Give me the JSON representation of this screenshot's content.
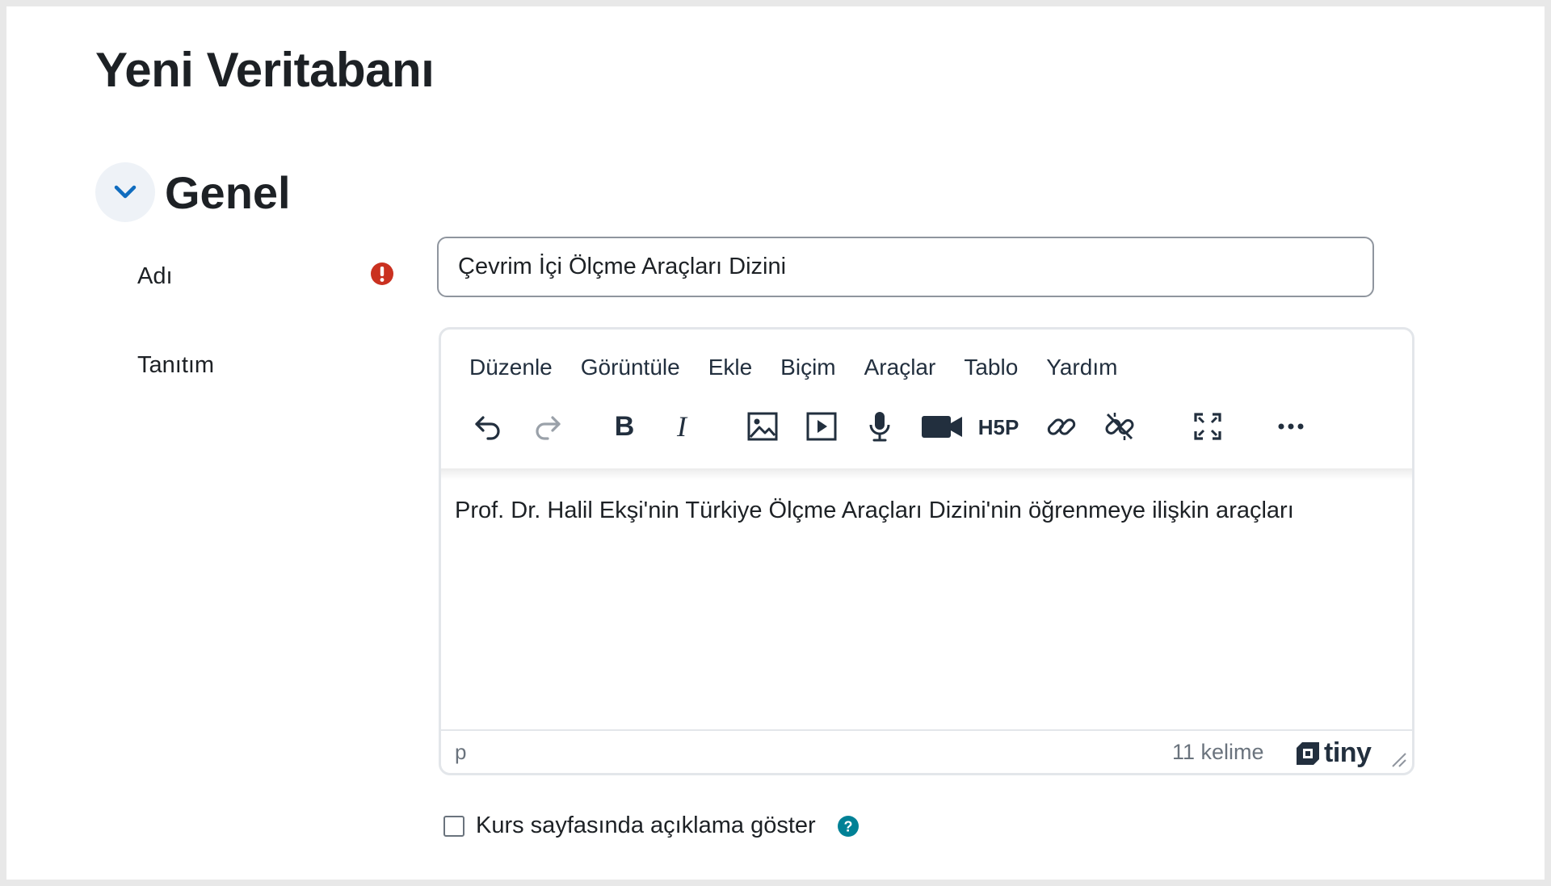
{
  "page": {
    "title": "Yeni Veritabanı"
  },
  "section": {
    "title": "Genel",
    "toggle_icon": "chevron-down-icon"
  },
  "fields": {
    "name": {
      "label": "Adı",
      "value": "Çevrim İçi Ölçme Araçları Dizini",
      "required_icon": "exclamation-circle-icon"
    },
    "description": {
      "label": "Tanıtım"
    }
  },
  "editor": {
    "menu": [
      "Düzenle",
      "Görüntüle",
      "Ekle",
      "Biçim",
      "Araçlar",
      "Tablo",
      "Yardım"
    ],
    "toolbar_icons": [
      "undo-icon",
      "redo-icon",
      "bold-icon",
      "italic-icon",
      "image-icon",
      "media-icon",
      "microphone-icon",
      "video-camera-icon",
      "h5p-icon",
      "link-icon",
      "unlink-icon",
      "fullscreen-icon",
      "more-icon"
    ],
    "content": "Prof. Dr. Halil Ekşi'nin Türkiye Ölçme Araçları Dizini'nin öğrenmeye ilişkin araçları",
    "status_path": "p",
    "word_count": "11 kelime",
    "brand": "tiny"
  },
  "show_description": {
    "label": "Kurs sayfasında açıklama göster",
    "checked": false,
    "help_icon": "question-circle-icon"
  },
  "colors": {
    "accent": "#0f6cbf",
    "required": "#ca3120",
    "help": "#008196",
    "text": "#1d2125",
    "muted": "#6a737d"
  }
}
